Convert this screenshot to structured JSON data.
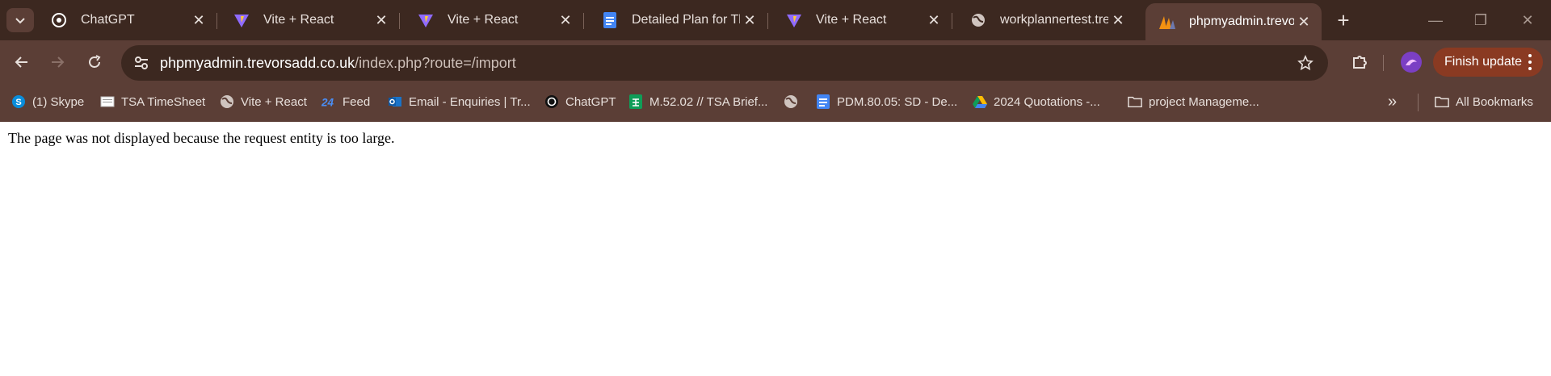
{
  "tabs": [
    {
      "title": "ChatGPT",
      "icon": "chatgpt-icon",
      "active": false
    },
    {
      "title": "Vite + React",
      "icon": "vite-icon",
      "active": false
    },
    {
      "title": "Vite + React",
      "icon": "vite-icon",
      "active": false
    },
    {
      "title": "Detailed Plan for The",
      "icon": "google-docs-icon",
      "active": false
    },
    {
      "title": "Vite + React",
      "icon": "vite-icon",
      "active": false
    },
    {
      "title": "workplannertest.trevo",
      "icon": "globe-icon",
      "active": false
    },
    {
      "title": "phpmyadmin.trevorsa",
      "icon": "phpmyadmin-icon",
      "active": true
    }
  ],
  "toolbar": {
    "url_host": "phpmyadmin.trevorsadd.co.uk",
    "url_path": "/index.php?route=/import",
    "update_label": "Finish update"
  },
  "bookmarks": [
    {
      "label": "(1) Skype",
      "icon": "skype-icon"
    },
    {
      "label": "TSA TimeSheet",
      "icon": "timesheet-icon"
    },
    {
      "label": "Vite + React",
      "icon": "globe-icon"
    },
    {
      "label": "Feed",
      "icon": "feed-icon"
    },
    {
      "label": "Email - Enquiries | Tr...",
      "icon": "outlook-icon"
    },
    {
      "label": "ChatGPT",
      "icon": "chatgpt-icon"
    },
    {
      "label": "M.52.02 // TSA Brief...",
      "icon": "google-sheets-icon"
    },
    {
      "label": "",
      "icon": "globe-icon"
    },
    {
      "label": "PDM.80.05: SD - De...",
      "icon": "google-docs-icon"
    },
    {
      "label": "2024 Quotations -...",
      "icon": "google-drive-icon"
    },
    {
      "label": "project Manageme...",
      "icon": "folder-icon"
    },
    {
      "label": "All Bookmarks",
      "icon": "folder-icon"
    }
  ],
  "colors": {
    "chrome": "#5b3e36",
    "tabstrip": "#3c2820",
    "update_button": "#8a3a22"
  },
  "page": {
    "message": "The page was not displayed because the request entity is too large."
  }
}
